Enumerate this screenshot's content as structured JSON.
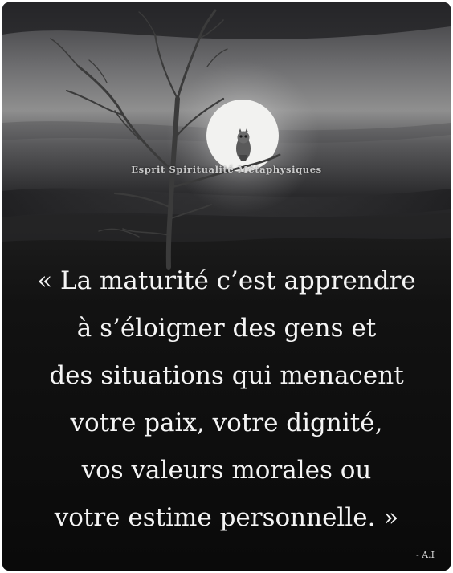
{
  "image": {
    "watermark": "Esprit Spiritualité Métaphysiques",
    "subject": "owl-on-bare-tree-full-moon",
    "colors": {
      "sky_dark": "#2b2b2e",
      "sky_light": "#a9a9a9",
      "moon": "#f2f2f0",
      "ground": "#111111",
      "text": "#f4f4f4"
    }
  },
  "quote": {
    "lines": [
      "« La maturité c’est apprendre",
      "à s’éloigner des gens et",
      "des situations qui menacent",
      "votre paix, votre dignité,",
      "vos valeurs morales ou",
      "votre estime personnelle. »"
    ],
    "author": "- A.I"
  }
}
